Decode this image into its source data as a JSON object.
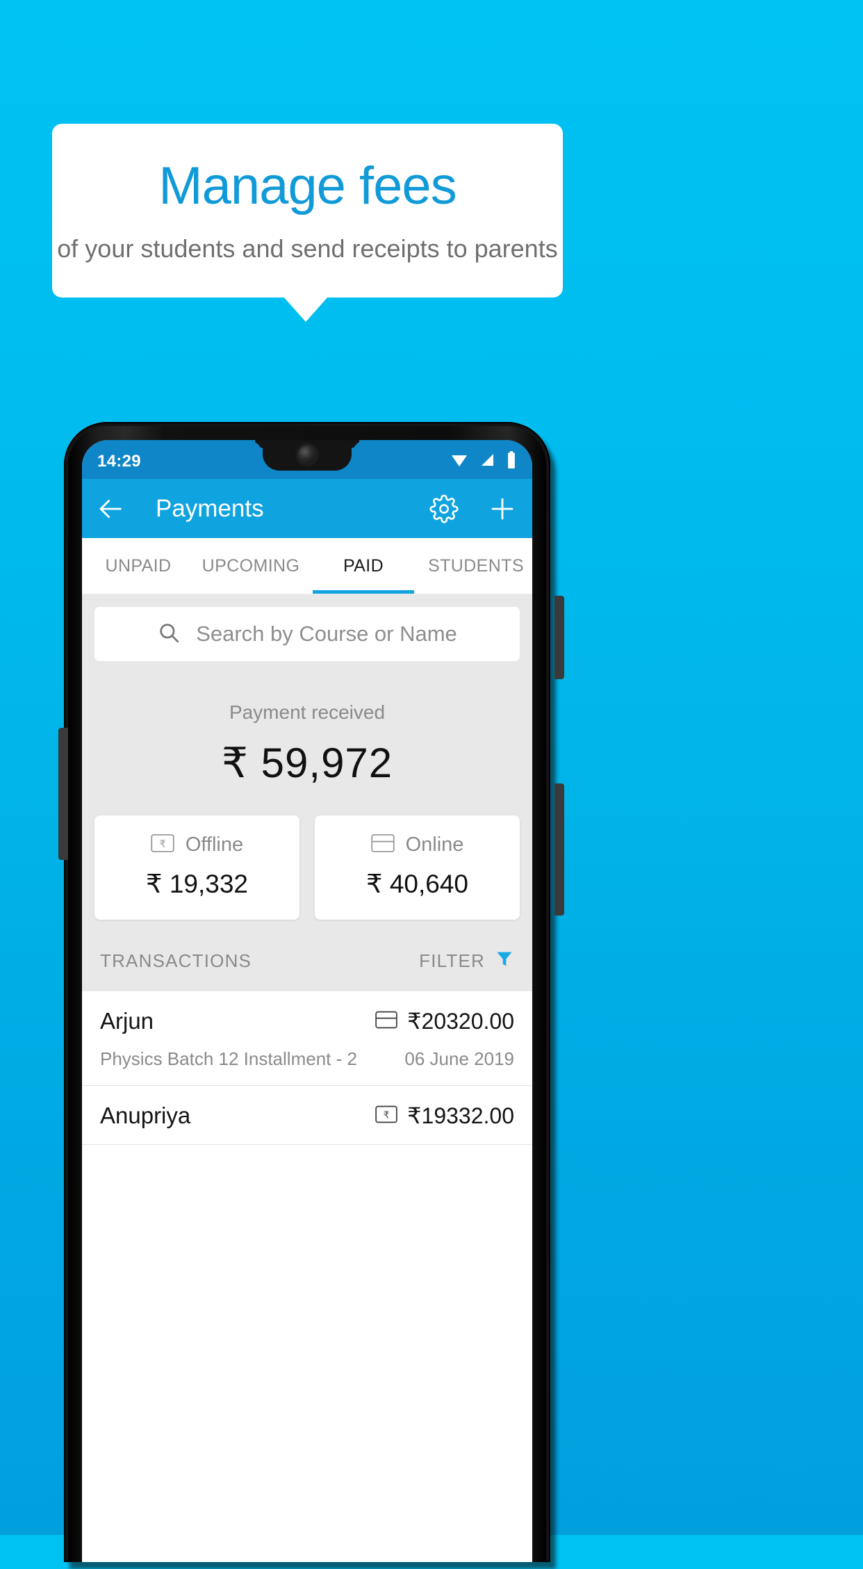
{
  "promo": {
    "title": "Manage fees",
    "subtitle": "of your students and send receipts to parents",
    "title_color": "#119ad8",
    "background_color": "#00b4ea"
  },
  "phone": {
    "status_bar": {
      "time": "14:29",
      "icons": [
        "wifi-icon",
        "signal-icon",
        "battery-icon"
      ],
      "background_color": "#0f86c8"
    },
    "app_bar": {
      "back_label": "back-arrow-icon",
      "title": "Payments",
      "actions": [
        "settings-gear-icon",
        "add-plus-icon"
      ],
      "background_color": "#0fa3e0"
    },
    "tabs": [
      {
        "label": "UNPAID",
        "active": false
      },
      {
        "label": "UPCOMING",
        "active": false
      },
      {
        "label": "PAID",
        "active": true
      },
      {
        "label": "STUDENTS",
        "active": false
      }
    ],
    "search": {
      "placeholder": "Search by Course or Name",
      "value": "",
      "icon": "search-icon"
    },
    "summary": {
      "label": "Payment received",
      "amount": "₹ 59,972"
    },
    "methods": [
      {
        "label": "Offline",
        "amount": "₹ 19,332",
        "icon": "rupee-note-icon"
      },
      {
        "label": "Online",
        "amount": "₹ 40,640",
        "icon": "credit-card-icon"
      }
    ],
    "transactions_header": {
      "title": "TRANSACTIONS",
      "filter_label": "FILTER",
      "filter_icon": "funnel-icon",
      "filter_icon_color": "#19a9e4"
    },
    "transactions": [
      {
        "name": "Arjun",
        "amount": "₹20320.00",
        "icon": "credit-card-icon",
        "description": "Physics Batch 12 Installment - 2",
        "date": "06 June 2019"
      },
      {
        "name": "Anupriya",
        "amount": "₹19332.00",
        "icon": "rupee-note-icon",
        "description": "",
        "date": ""
      }
    ]
  }
}
